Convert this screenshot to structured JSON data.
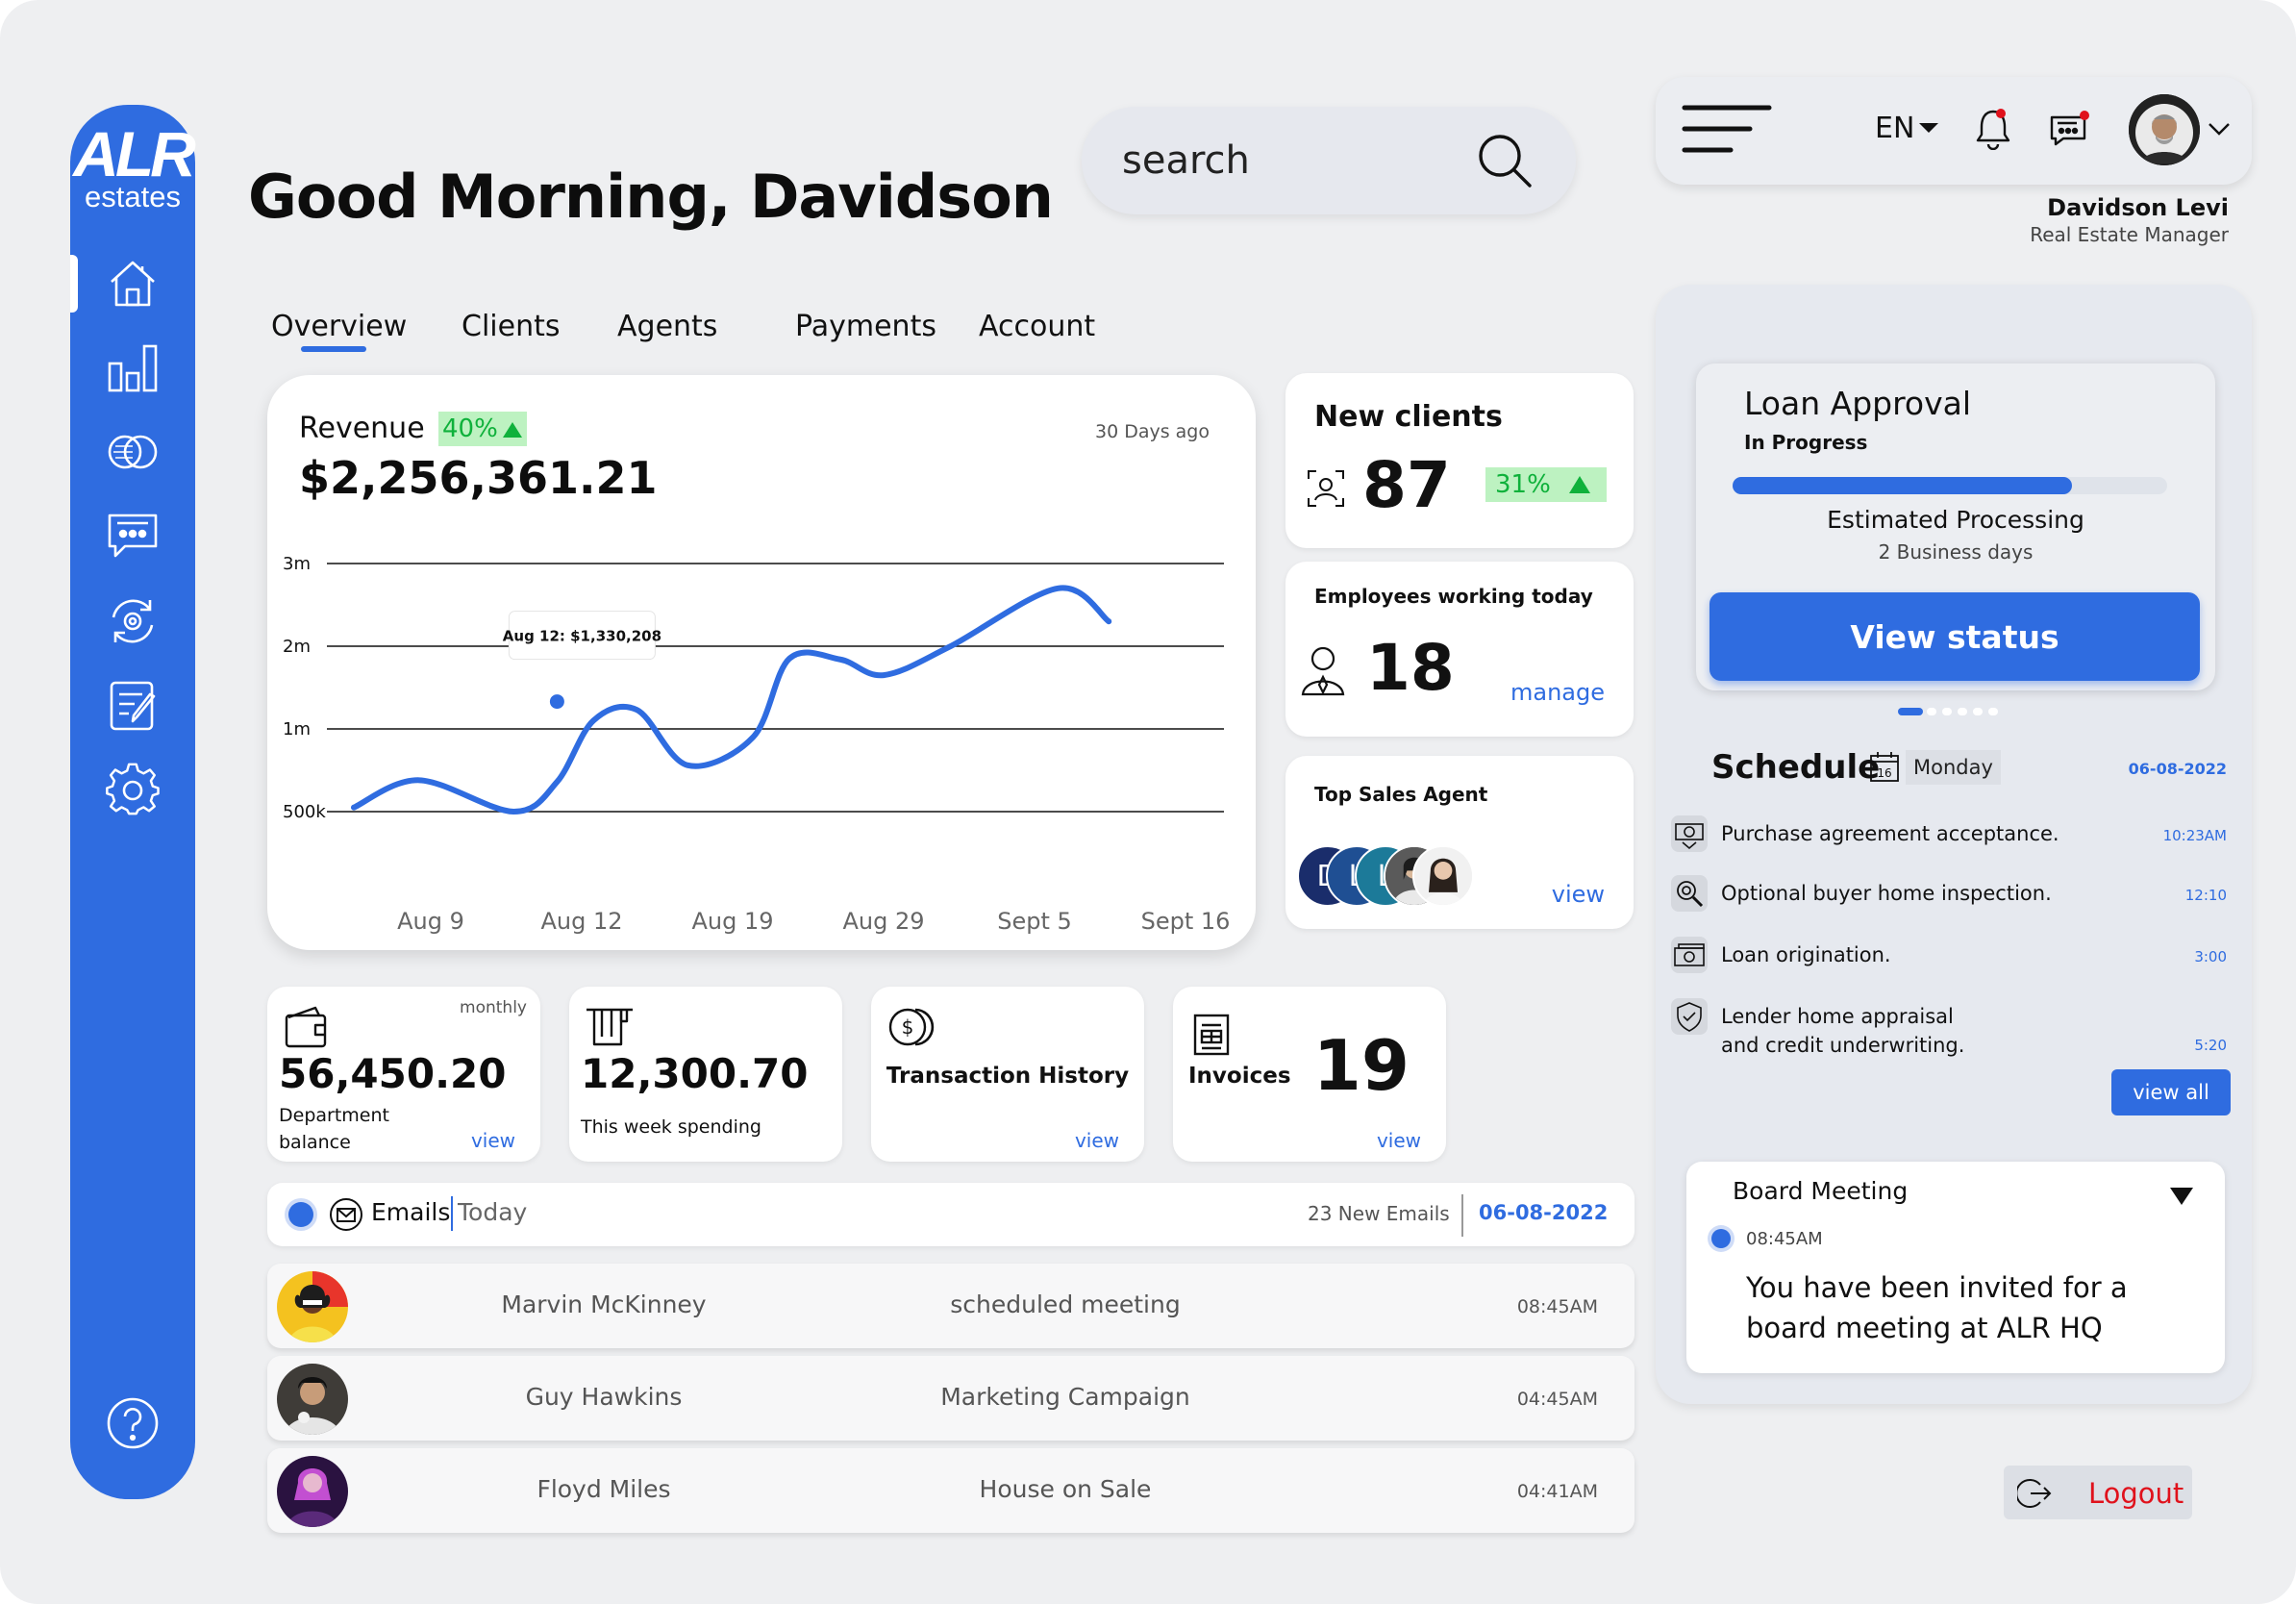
{
  "app": {
    "logo_top": "ALR",
    "logo_bottom": "estates"
  },
  "header": {
    "greeting": "Good Morning, Davidson",
    "search_placeholder": "search"
  },
  "sidebar": {
    "items": [
      {
        "name": "home-icon",
        "active": true
      },
      {
        "name": "bar-chart-icon"
      },
      {
        "name": "cards-icon"
      },
      {
        "name": "chat-icon"
      },
      {
        "name": "sync-settings-icon"
      },
      {
        "name": "edit-note-icon"
      },
      {
        "name": "gear-icon"
      }
    ],
    "help_icon": "question-circle-icon"
  },
  "tabs": [
    {
      "label": "Overview",
      "active": true
    },
    {
      "label": "Clients"
    },
    {
      "label": "Agents"
    },
    {
      "label": "Payments"
    },
    {
      "label": "Account"
    }
  ],
  "revenue": {
    "label": "Revenue",
    "change": "40%",
    "value": "$2,256,361.21",
    "period": "30 Days ago",
    "tooltip": "Aug 12: $1,330,208"
  },
  "chart_data": {
    "type": "line",
    "categories": [
      "Aug 9",
      "Aug 12",
      "Aug 19",
      "Aug 29",
      "Sept 5",
      "Sept 16"
    ],
    "y_tick_labels": [
      "3m",
      "2m",
      "1m",
      "500k"
    ],
    "y_tick_values": [
      3000000,
      2000000,
      1000000,
      0
    ],
    "series": [
      {
        "points": [
          {
            "x": 0.0,
            "y": 50000
          },
          {
            "x": 0.45,
            "y": 380000
          },
          {
            "x": 1.1,
            "y": 0
          },
          {
            "x": 1.4,
            "y": 360000
          },
          {
            "x": 1.65,
            "y": 1100000
          },
          {
            "x": 1.95,
            "y": 1230000
          },
          {
            "x": 2.3,
            "y": 560000
          },
          {
            "x": 2.75,
            "y": 900000
          },
          {
            "x": 3.0,
            "y": 1850000
          },
          {
            "x": 3.35,
            "y": 1840000
          },
          {
            "x": 3.65,
            "y": 1650000
          },
          {
            "x": 4.1,
            "y": 1990000
          },
          {
            "x": 4.85,
            "y": 2700000
          },
          {
            "x": 5.2,
            "y": 2300000
          }
        ]
      }
    ],
    "highlight": {
      "x": 1.4,
      "y": 1330208,
      "label": "Aug 12: $1,330,208"
    },
    "grid": "horizontal",
    "colors": {
      "line": "#2f6ce0"
    }
  },
  "new_clients": {
    "title": "New clients",
    "value": "87",
    "change": "31%"
  },
  "employees": {
    "title": "Employees working today",
    "value": "18",
    "action": "manage"
  },
  "top_agent": {
    "title": "Top Sales Agent",
    "initials": [
      "D",
      "L",
      "L"
    ],
    "action": "view"
  },
  "stats": {
    "dept": {
      "period": "monthly",
      "value": "56,450.20",
      "label": "Department\nbalance",
      "action": "view"
    },
    "week": {
      "value": "12,300.70",
      "label": "This week spending"
    },
    "transactions": {
      "label": "Transaction History",
      "action": "view"
    },
    "invoices": {
      "label": "Invoices",
      "value": "19",
      "action": "view"
    }
  },
  "emails": {
    "title": "Emails",
    "filter": "Today",
    "count": "23 New Emails",
    "date": "06-08-2022",
    "rows": [
      {
        "name": "Marvin McKinney",
        "subject": "scheduled meeting",
        "time": "08:45AM"
      },
      {
        "name": "Guy Hawkins",
        "subject": "Marketing Campaign",
        "time": "04:45AM"
      },
      {
        "name": "Floyd Miles",
        "subject": "House on Sale",
        "time": "04:41AM"
      }
    ]
  },
  "topbar": {
    "lang": "EN",
    "user_name": "Davidson Levi",
    "user_role": "Real Estate Manager"
  },
  "loan": {
    "title": "Loan Approval",
    "status": "In Progress",
    "progress": 0.78,
    "estimate_label": "Estimated Processing",
    "estimate_value": "2 Business days",
    "button": "View status"
  },
  "schedule": {
    "title": "Schedule",
    "calendar_day": "16",
    "day": "Monday",
    "date": "06-08-2022",
    "items": [
      {
        "icon": "money-icon",
        "text": "Purchase agreement acceptance.",
        "time": "10:23AM"
      },
      {
        "icon": "magnifier-icon",
        "text": "Optional buyer home inspection.",
        "time": "12:10"
      },
      {
        "icon": "cash-icon",
        "text": "Loan origination.",
        "time": "3:00"
      },
      {
        "icon": "shield-check-icon",
        "text": "Lender home appraisal\nand credit underwriting.",
        "time": "5:20"
      }
    ],
    "view_all": "view all"
  },
  "meeting": {
    "title": "Board Meeting",
    "time": "08:45AM",
    "text": "You have been invited for a board meeting at ALR HQ"
  },
  "logout": {
    "label": "Logout"
  },
  "colors": {
    "accent": "#2f6ce0",
    "positive": "#0fb13b",
    "danger": "#e0121c"
  }
}
